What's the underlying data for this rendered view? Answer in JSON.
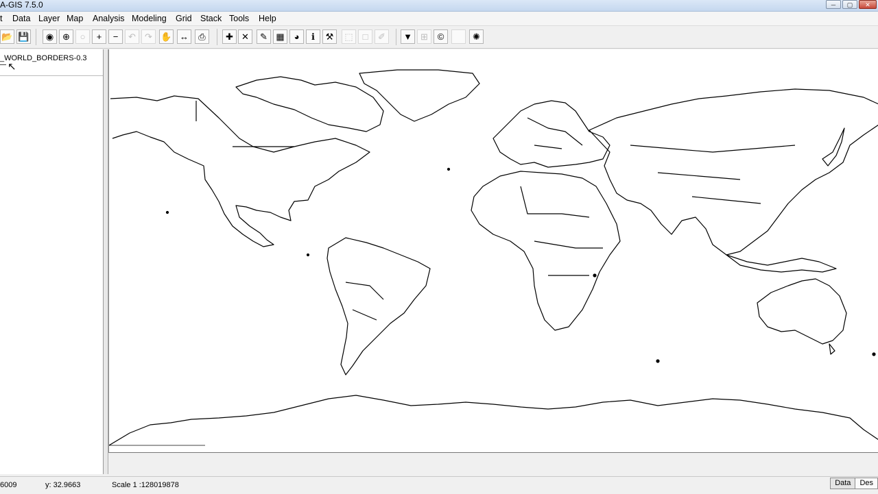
{
  "window": {
    "title": "A-GIS 7.5.0",
    "min_glyph": "─",
    "max_glyph": "▢",
    "close_glyph": "✕"
  },
  "menu": [
    "t",
    "Data",
    "Layer",
    "Map",
    "Analysis",
    "Modeling",
    "Grid",
    "Stack",
    "Tools",
    "Help"
  ],
  "toolbar": {
    "buttons": [
      {
        "name": "open-folder-icon",
        "glyph": "📂",
        "dim": false
      },
      {
        "name": "save-icon",
        "glyph": "💾",
        "dim": false
      },
      {
        "name": "globe-icon",
        "glyph": "◉",
        "dim": false
      },
      {
        "name": "zoom-extent-icon",
        "glyph": "⊕",
        "dim": false
      },
      {
        "name": "zoom-selected-icon",
        "glyph": "○",
        "dim": true
      },
      {
        "name": "zoom-in-icon",
        "glyph": "+",
        "dim": false
      },
      {
        "name": "zoom-out-icon",
        "glyph": "−",
        "dim": false
      },
      {
        "name": "undo-icon",
        "glyph": "↶",
        "dim": true
      },
      {
        "name": "redo-icon",
        "glyph": "↷",
        "dim": true
      },
      {
        "name": "pan-hand-icon",
        "glyph": "✋",
        "dim": false
      },
      {
        "name": "measure-icon",
        "glyph": "↔",
        "dim": false
      },
      {
        "name": "export-image-icon",
        "glyph": "⎙",
        "dim": false
      },
      {
        "name": "add-layer-icon",
        "glyph": "✚",
        "dim": false
      },
      {
        "name": "remove-layer-icon",
        "glyph": "✕",
        "dim": false
      },
      {
        "name": "paintbrush-icon",
        "glyph": "✎",
        "dim": false
      },
      {
        "name": "attribute-table-icon",
        "glyph": "▦",
        "dim": false
      },
      {
        "name": "color-wheel-icon",
        "glyph": "◕",
        "dim": false
      },
      {
        "name": "info-icon",
        "glyph": "ℹ",
        "dim": false
      },
      {
        "name": "tools-icon",
        "glyph": "⚒",
        "dim": false
      },
      {
        "name": "select-box-icon",
        "glyph": "⬚",
        "dim": true
      },
      {
        "name": "blank-tool-icon",
        "glyph": "□",
        "dim": true
      },
      {
        "name": "edit-disabled-icon",
        "glyph": "✐",
        "dim": true
      },
      {
        "name": "map-grid-icon",
        "glyph": "▼",
        "dim": false
      },
      {
        "name": "grid-icon",
        "glyph": "⊞",
        "dim": true
      },
      {
        "name": "copyright-icon",
        "glyph": "©",
        "dim": false
      },
      {
        "name": "blank-icon",
        "glyph": " ",
        "dim": true
      },
      {
        "name": "sun-icon",
        "glyph": "✺",
        "dim": false
      }
    ]
  },
  "layers": [
    {
      "name": "_WORLD_BORDERS-0.3"
    }
  ],
  "status": {
    "x_readout": "6009",
    "y_readout": "y: 32.9663",
    "scale": "Scale 1 :128019878"
  },
  "tabs": [
    {
      "label": "Data"
    },
    {
      "label": "Des"
    }
  ],
  "colors": {
    "map_background": "#ffffff",
    "map_outline": "#000000"
  }
}
